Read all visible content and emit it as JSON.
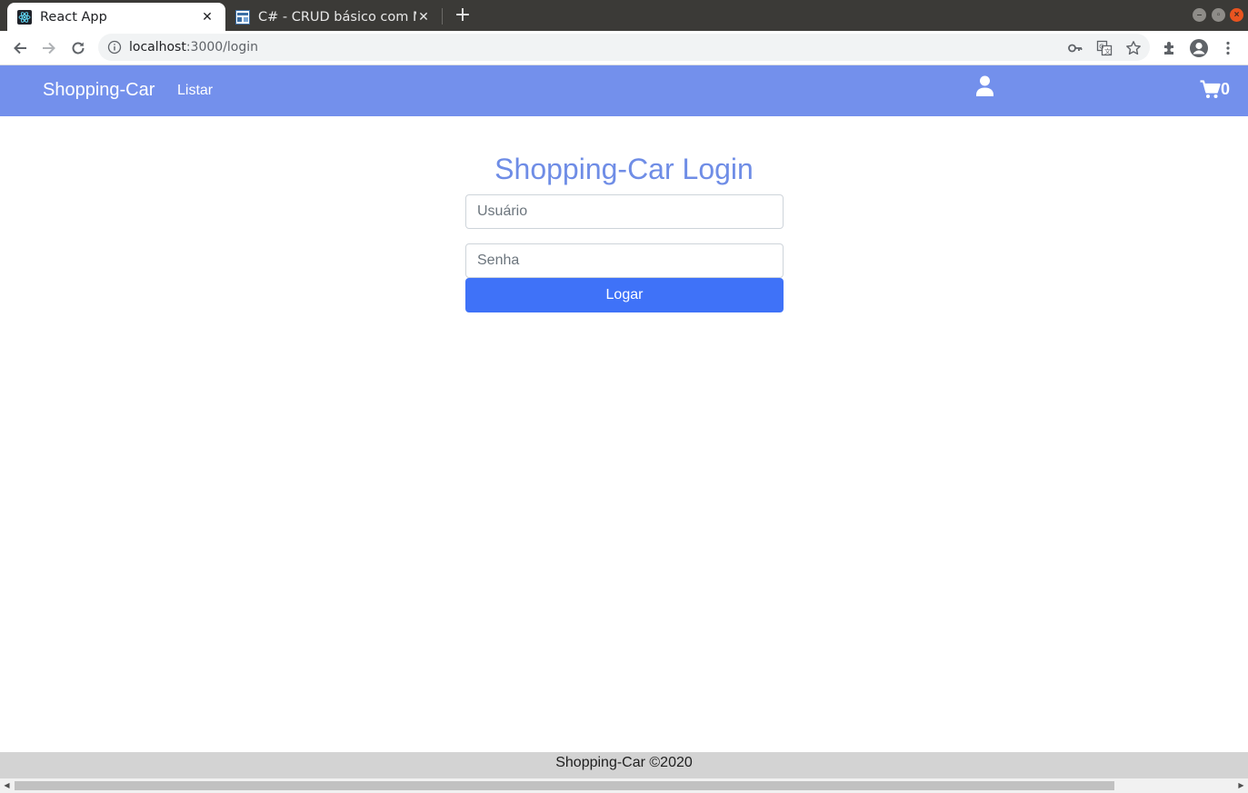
{
  "browser": {
    "tabs": [
      {
        "title": "React App",
        "icon": "react-icon",
        "active": true
      },
      {
        "title": "C# - CRUD básico com Mo",
        "icon": "devmedia-icon",
        "active": false
      }
    ],
    "new_tab_symbol": "+",
    "close_symbol": "✕",
    "url_host": "localhost",
    "url_rest": ":3000/login"
  },
  "navbar": {
    "brand": "Shopping-Car",
    "links": [
      "Listar"
    ],
    "cart_count": "0",
    "color": "#7390ec"
  },
  "login": {
    "title": "Shopping-Car Login",
    "username_placeholder": "Usuário",
    "password_placeholder": "Senha",
    "submit_label": "Logar",
    "title_color": "#6f8de6",
    "button_color": "#3f72f8"
  },
  "footer": {
    "text": "Shopping-Car ©2020"
  }
}
